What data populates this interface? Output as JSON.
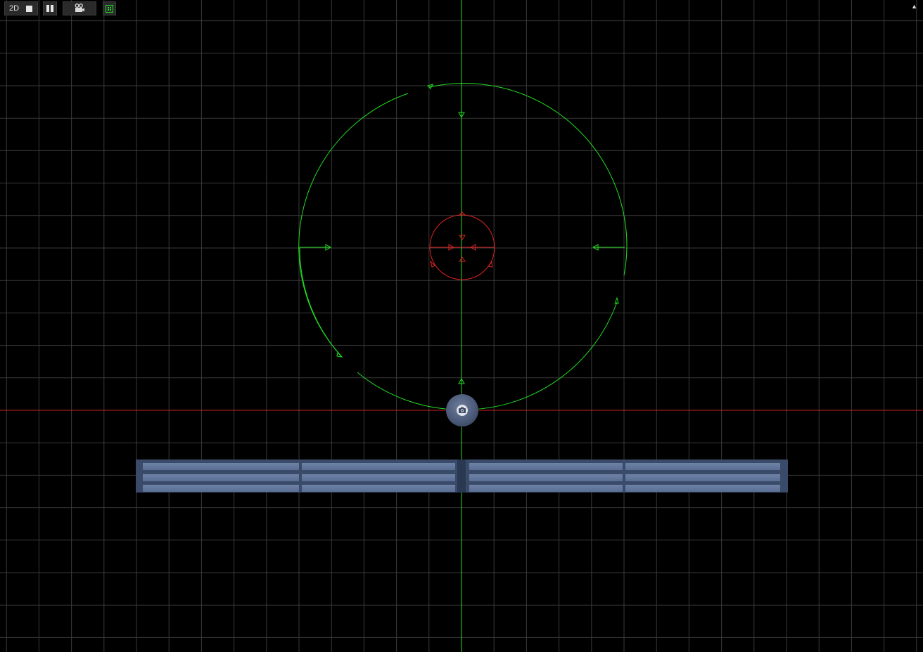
{
  "toolbar": {
    "view_mode_label": "2D",
    "split_icon": "split-view-icon",
    "camera_icon": "video-camera-icon",
    "frame_icon": "frame-selection-icon",
    "collapse_icon": "collapse-up-icon"
  },
  "colors": {
    "background": "#000000",
    "grid": "#3a3a3a",
    "axis_vertical": "#22dd22",
    "axis_horizontal": "#cc2222",
    "outer_circle": "#22dd22",
    "inner_circle": "#dd2222",
    "strip": "#3a4b6a",
    "camera_node": "#4b5a78"
  },
  "scene": {
    "camera_node_icon": "camera-icon",
    "strip_rows": 3,
    "strip_columns": 4
  }
}
